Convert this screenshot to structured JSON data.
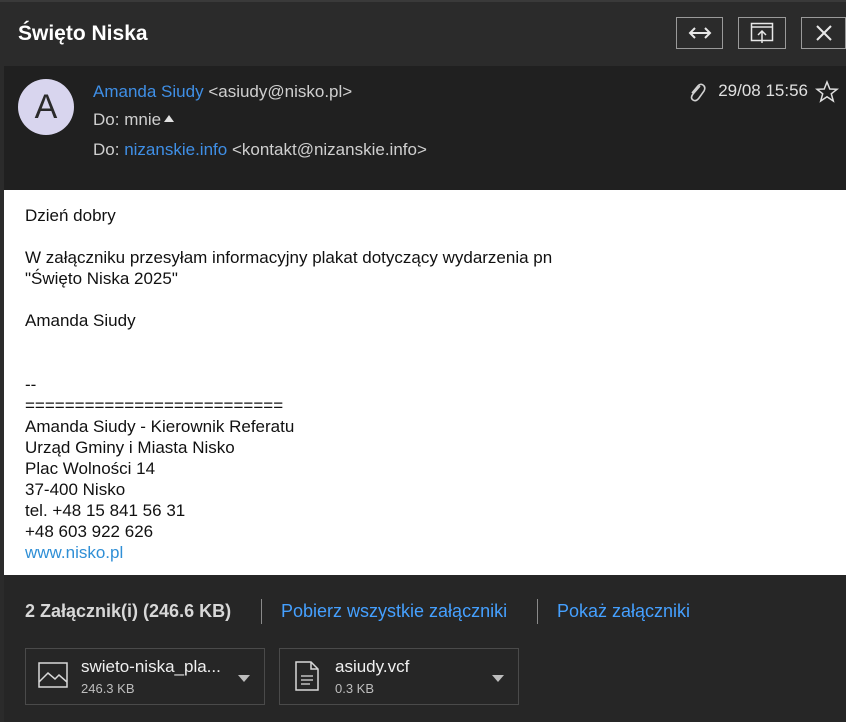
{
  "window": {
    "title": "Święto Niska",
    "buttons": [
      {
        "name": "expand-button",
        "icon": "double-arrow-icon"
      },
      {
        "name": "popout-button",
        "icon": "popout-window-icon"
      },
      {
        "name": "close-button",
        "icon": "close-icon"
      }
    ]
  },
  "header": {
    "avatar_letter": "A",
    "from_name": "Amanda Siudy",
    "from_email": "<asiudy@nisko.pl>",
    "to_label": "Do:",
    "to_self": "mnie",
    "to2_label": "Do:",
    "to2_name": "nizanskie.info",
    "to2_email": "<kontakt@nizanskie.info>",
    "datetime": "29/08 15:56"
  },
  "body": {
    "lines": [
      "Dzień dobry",
      "W załączniku przesyłam informacyjny plakat dotyczący wydarzenia pn",
      "\"Święto Niska 2025\"",
      "Amanda Siudy",
      "--",
      "==========================",
      "Amanda Siudy - Kierownik Referatu",
      "Urząd Gminy i Miasta Nisko",
      "Plac Wolności 14",
      "37-400 Nisko",
      "tel. +48 15 841 56 31",
      "+48 603 922 626"
    ],
    "website": "www.nisko.pl"
  },
  "attachments": {
    "count_label": "2 Załącznik(i) (246.6 KB)",
    "download_all": "Pobierz wszystkie załączniki",
    "show_all": "Pokaż załączniki",
    "files": [
      {
        "name": "swieto-niska_pla...",
        "size": "246.3 KB",
        "icon": "image-file-icon"
      },
      {
        "name": "asiudy.vcf",
        "size": "0.3 KB",
        "icon": "document-file-icon"
      }
    ]
  },
  "colors": {
    "link": "#3f8fe6",
    "background": "#2b2b2b",
    "avatar": "#d8d5ee"
  }
}
